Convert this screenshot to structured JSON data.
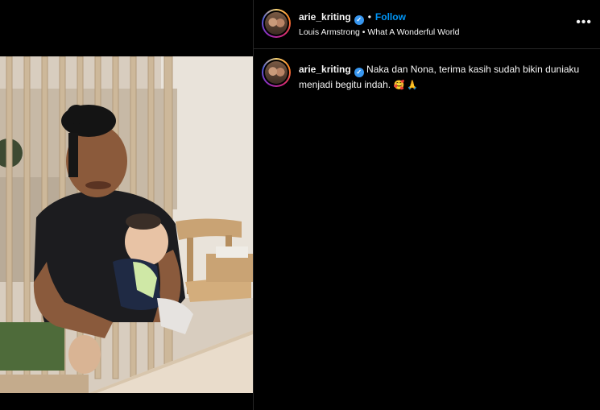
{
  "header": {
    "username": "arie_kriting",
    "verified_icon": "verified-badge-icon",
    "separator": "•",
    "follow_label": "Follow",
    "audio_artist": "Louis Armstrong",
    "audio_separator": "•",
    "audio_title": "What A Wonderful World",
    "more_label": "•••"
  },
  "caption": {
    "username": "arie_kriting",
    "text": "Naka dan Nona, terima kasih sudah bikin duniaku menjadi begitu indah.",
    "emojis": "🥰 🙏"
  },
  "colors": {
    "background": "#000000",
    "follow": "#0095f6",
    "verified": "#3897f0",
    "divider": "#262626"
  }
}
